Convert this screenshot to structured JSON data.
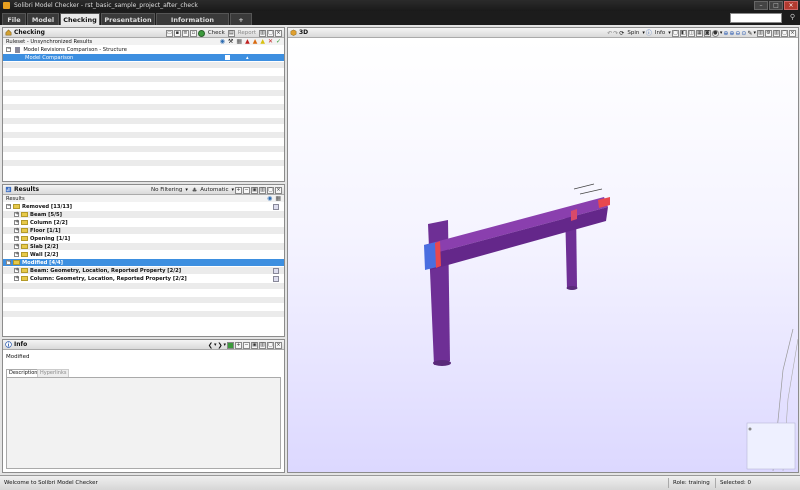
{
  "window": {
    "title": "Solibri Model Checker - rst_basic_sample_project_after_check"
  },
  "tabs": [
    {
      "label": "File"
    },
    {
      "label": "Model"
    },
    {
      "label": "Checking"
    },
    {
      "label": "Presentation"
    },
    {
      "label": "Information Takeoff"
    },
    {
      "label": "+"
    }
  ],
  "checking": {
    "title": "Checking",
    "check_label": "Check",
    "report_label": "Report",
    "ruleset_header": "Ruleset - Unsynchronized Results",
    "rows": [
      {
        "label": "Model Revisions Comparison - Structure"
      },
      {
        "label": "Model Comparison"
      }
    ]
  },
  "results": {
    "title": "Results",
    "filter_label": "No Filtering",
    "sort_label": "Automatic",
    "header": "Results",
    "removed": {
      "label": "Removed [13/13]",
      "items": [
        {
          "label": "Beam [5/5]"
        },
        {
          "label": "Column [2/2]"
        },
        {
          "label": "Floor [1/1]"
        },
        {
          "label": "Opening [1/1]"
        },
        {
          "label": "Slab [2/2]"
        },
        {
          "label": "Wall [2/2]"
        }
      ]
    },
    "modified": {
      "label": "Modified [4/4]",
      "items": [
        {
          "label": "Beam: Geometry, Location, Reported Property [2/2]"
        },
        {
          "label": "Column: Geometry, Location, Reported Property [2/2]"
        }
      ]
    }
  },
  "info": {
    "title": "Info",
    "value": "Modified",
    "tabs": [
      {
        "label": "Description"
      },
      {
        "label": "Hyperlinks"
      }
    ]
  },
  "view3d": {
    "title": "3D",
    "spin_label": "Spin",
    "info_label": "Info",
    "colors": {
      "member": "#7a3a9e",
      "member_dark": "#5a2a7a",
      "highlight_red": "#e8484e",
      "highlight_blue": "#4a6ee0"
    }
  },
  "status": {
    "message": "Welcome to Solibri Model Checker",
    "role": "Role: training",
    "selected": "Selected: 0"
  }
}
